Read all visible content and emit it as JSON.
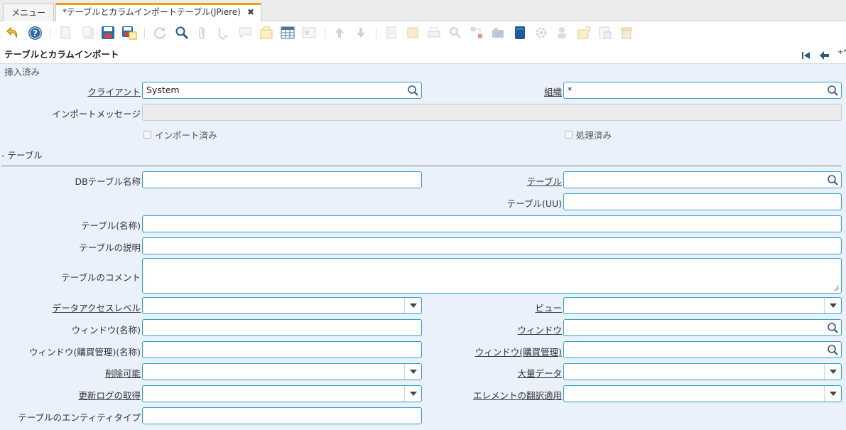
{
  "tabs": [
    {
      "label": "メニュー"
    },
    {
      "label": "*テーブルとカラムインポートテーブル(JPiere)"
    }
  ],
  "tab_close": "✖",
  "window_title": "テーブルとカラムインポート",
  "nav_more": "+*",
  "sections": {
    "inserted": "挿入済み",
    "table": "- テーブル"
  },
  "fields": {
    "client": {
      "label": "クライアント",
      "value": "System"
    },
    "org": {
      "label": "組織",
      "value": "*"
    },
    "import_message": {
      "label": "インポートメッセージ",
      "value": ""
    },
    "imported": {
      "label": "インポート済み"
    },
    "processed": {
      "label": "処理済み"
    },
    "db_table_name": {
      "label": "DBテーブル名称",
      "value": ""
    },
    "table": {
      "label": "テーブル",
      "value": ""
    },
    "table_uu": {
      "label": "テーブル(UU)",
      "value": ""
    },
    "table_name": {
      "label": "テーブル(名称)",
      "value": ""
    },
    "table_description": {
      "label": "テーブルの説明",
      "value": ""
    },
    "table_comment": {
      "label": "テーブルのコメント",
      "value": ""
    },
    "data_access_level": {
      "label": "データアクセスレベル",
      "value": ""
    },
    "view": {
      "label": "ビュー",
      "value": ""
    },
    "window_name": {
      "label": "ウィンドウ(名称)",
      "value": ""
    },
    "window": {
      "label": "ウィンドウ",
      "value": ""
    },
    "po_window_name": {
      "label": "ウィンドウ(購買管理)(名称)",
      "value": ""
    },
    "po_window": {
      "label": "ウィンドウ(購買管理)",
      "value": ""
    },
    "deleteable": {
      "label": "削除可能",
      "value": ""
    },
    "high_volume": {
      "label": "大量データ",
      "value": ""
    },
    "change_log": {
      "label": "更新ログの取得",
      "value": ""
    },
    "translation": {
      "label": "エレメントの翻訳適用",
      "value": ""
    },
    "entity_type": {
      "label": "テーブルのエンティティタイプ",
      "value": ""
    }
  },
  "colors": {
    "accent": "#f39c12",
    "field_border": "#2fa3c9",
    "form_bg": "#eaf1fb",
    "icon_blue": "#2c6aa8"
  }
}
